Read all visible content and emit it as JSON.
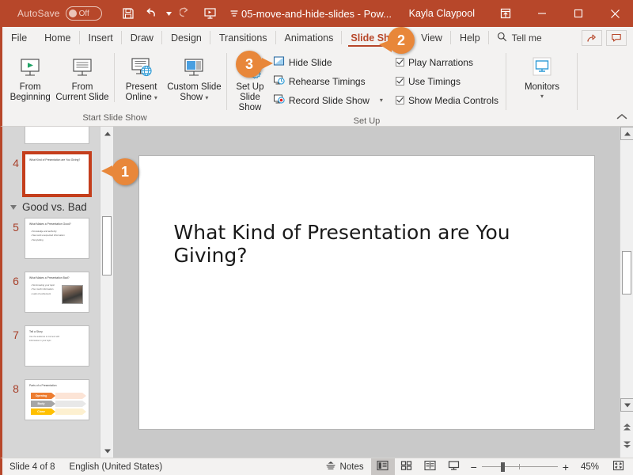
{
  "titlebar": {
    "autosave_label": "AutoSave",
    "autosave_state": "Off",
    "save_icon": "save-icon",
    "undo_icon": "undo-icon",
    "redo_icon": "redo-icon",
    "present_icon": "start-presentation-icon",
    "customize_icon": "customize-qat-icon",
    "document_title": "05-move-and-hide-slides  -  Pow...",
    "account_name": "Kayla Claypool",
    "ribbon_display_icon": "ribbon-display-options-icon",
    "minimize": "—",
    "maximize": "▢",
    "close": "✕",
    "accent_color": "#b7472a"
  },
  "tabs": {
    "items": [
      {
        "label": "File"
      },
      {
        "label": "Home"
      },
      {
        "label": "Insert"
      },
      {
        "label": "Draw"
      },
      {
        "label": "Design"
      },
      {
        "label": "Transitions"
      },
      {
        "label": "Animations"
      },
      {
        "label": "Slide Show"
      },
      {
        "label": "View"
      },
      {
        "label": "Help"
      }
    ],
    "active": "Slide Show",
    "tell_me": "Tell me",
    "share_icon": "share-icon",
    "comments_icon": "comments-icon"
  },
  "ribbon": {
    "groups": [
      {
        "name": "Start Slide Show",
        "buttons": [
          {
            "label_line1": "From",
            "label_line2": "Beginning",
            "icon": "from-beginning-icon"
          },
          {
            "label_line1": "From",
            "label_line2": "Current Slide",
            "icon": "from-current-slide-icon"
          },
          {
            "label_line1": "Present",
            "label_line2": "Online",
            "icon": "present-online-icon",
            "dropdown": true
          },
          {
            "label_line1": "Custom Slide",
            "label_line2": "Show",
            "icon": "custom-slide-show-icon",
            "dropdown": true
          }
        ]
      },
      {
        "name": "Set Up",
        "buttons": [
          {
            "label_line1": "Set Up",
            "label_line2": "Slide Show",
            "icon": "set-up-slide-show-icon"
          }
        ],
        "small_buttons": [
          {
            "label": "Hide Slide",
            "icon": "hide-slide-icon"
          },
          {
            "label": "Rehearse Timings",
            "icon": "rehearse-timings-icon"
          },
          {
            "label": "Record Slide Show",
            "icon": "record-slide-show-icon",
            "dropdown": true
          }
        ],
        "checkboxes": [
          {
            "label": "Play Narrations",
            "checked": true
          },
          {
            "label": "Use Timings",
            "checked": true
          },
          {
            "label": "Show Media Controls",
            "checked": true
          }
        ]
      },
      {
        "name": "",
        "buttons": [
          {
            "label_line1": "Monitors",
            "label_line2": "",
            "icon": "monitors-icon",
            "dropdown": true
          }
        ]
      }
    ],
    "collapse_icon": "collapse-ribbon-icon"
  },
  "thumbnails": {
    "scroll_up_icon": "scroll-up-icon",
    "scroll_down_icon": "scroll-down-icon",
    "section_label": "Good vs. Bad",
    "section_collapse_icon": "section-collapse-icon",
    "slides": [
      {
        "number": "",
        "title": "",
        "partial": true
      },
      {
        "number": "4",
        "title": "What Kind of Presentation are You Giving?",
        "selected": true
      },
      {
        "number": "5",
        "title": "What Makes a Presentation Good?",
        "bullets": [
          "Knowledge and authority",
          "New and unexpected information",
          "Storytelling"
        ]
      },
      {
        "number": "6",
        "title": "What Makes a Presentation Bad?",
        "bullets": [
          "Not knowing your topic",
          "Too much information",
          "Lack of excitement"
        ],
        "photo": true
      },
      {
        "number": "7",
        "title": "Tell a Story",
        "subtext": "Use the audience to connect with information in your topic"
      },
      {
        "number": "8",
        "title": "Parts of a Presentation",
        "chevrons": [
          {
            "label": "Opening",
            "color": "#ed7d31"
          },
          {
            "label": "Body",
            "color": "#a6a6a6"
          },
          {
            "label": "Close",
            "color": "#ffc000"
          }
        ]
      }
    ]
  },
  "slide": {
    "title": "What Kind of Presentation are You Giving?"
  },
  "statusbar": {
    "slide_counter": "Slide 4 of 8",
    "language": "English (United States)",
    "notes_label": "Notes",
    "notes_icon": "notes-icon",
    "views": [
      {
        "name": "normal-view",
        "icon": "normal-view-icon",
        "active": true
      },
      {
        "name": "slide-sorter-view",
        "icon": "slide-sorter-icon",
        "active": false
      },
      {
        "name": "reading-view",
        "icon": "reading-view-icon",
        "active": false
      },
      {
        "name": "slide-show-view",
        "icon": "slide-show-icon",
        "active": false
      }
    ],
    "zoom_out": "−",
    "zoom_in": "+",
    "zoom_level": "45%",
    "fit_icon": "fit-to-window-icon"
  },
  "callouts": [
    {
      "number": "1",
      "target": "selected-slide-thumbnail"
    },
    {
      "number": "2",
      "target": "slide-show-tab"
    },
    {
      "number": "3",
      "target": "hide-slide-button"
    }
  ]
}
